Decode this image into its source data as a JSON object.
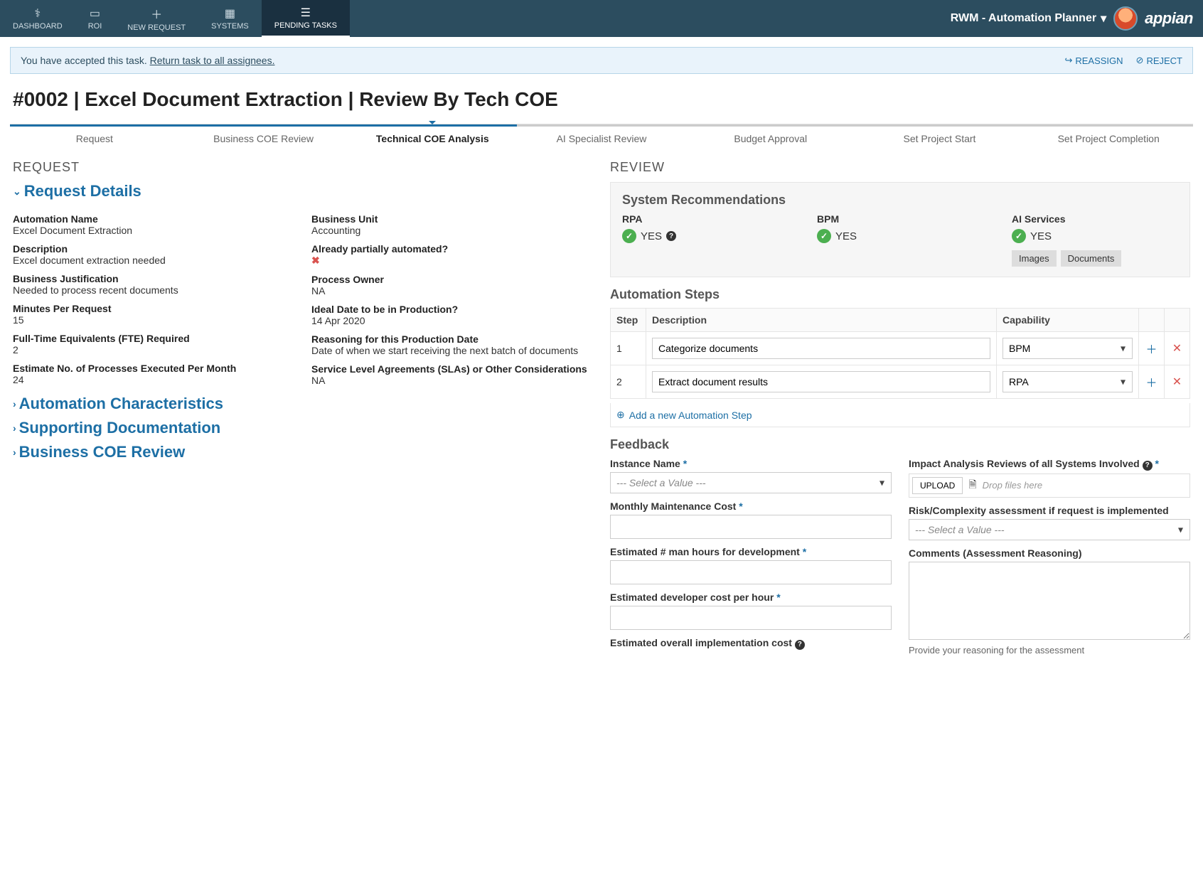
{
  "topnav": {
    "tabs": [
      {
        "icon": "⎍",
        "label": "DASHBOARD"
      },
      {
        "icon": "⬚",
        "label": "ROI"
      },
      {
        "icon": "＋",
        "label": "NEW REQUEST"
      },
      {
        "icon": "▦",
        "label": "SYSTEMS"
      },
      {
        "icon": "☰",
        "label": "PENDING TASKS"
      }
    ],
    "app_name": "RWM - Automation Planner",
    "logo": "appian"
  },
  "banner": {
    "text": "You have accepted this task.",
    "link": "Return task to all assignees.",
    "reassign": "REASSIGN",
    "reject": "REJECT"
  },
  "page_title": "#0002 | Excel Document Extraction | Review By Tech COE",
  "subtabs": [
    "Request",
    "Business COE Review",
    "Technical COE Analysis",
    "AI Specialist Review",
    "Budget Approval",
    "Set Project Start",
    "Set Project Completion"
  ],
  "active_subtab": 2,
  "request": {
    "section": "REQUEST",
    "accordion_open": "Request Details",
    "fields_left": [
      {
        "label": "Automation Name",
        "value": "Excel Document Extraction"
      },
      {
        "label": "Description",
        "value": "Excel document extraction needed"
      },
      {
        "label": "Business Justification",
        "value": "Needed to process recent documents"
      },
      {
        "label": "Minutes Per Request",
        "value": "15"
      },
      {
        "label": "Full-Time Equivalents (FTE) Required",
        "value": "2"
      },
      {
        "label": "Estimate No. of Processes Executed Per Month",
        "value": "24"
      }
    ],
    "fields_right": [
      {
        "label": "Business Unit",
        "value": "Accounting"
      },
      {
        "label": "Already partially automated?",
        "value": "x",
        "red": true
      },
      {
        "label": "Process Owner",
        "value": "NA"
      },
      {
        "label": "Ideal Date to be in Production?",
        "value": "14 Apr 2020"
      },
      {
        "label": "Reasoning for this Production Date",
        "value": "Date of when we start receiving the next batch of documents"
      },
      {
        "label": "Service Level Agreements (SLAs) or Other Considerations",
        "value": "NA"
      }
    ],
    "accordions_closed": [
      "Automation Characteristics",
      "Supporting Documentation",
      "Business COE Review"
    ]
  },
  "review": {
    "section": "REVIEW",
    "recommendations": {
      "title": "System Recommendations",
      "cols": [
        {
          "label": "RPA",
          "value": "YES",
          "help": true
        },
        {
          "label": "BPM",
          "value": "YES"
        },
        {
          "label": "AI Services",
          "value": "YES",
          "chips": [
            "Images",
            "Documents"
          ]
        }
      ]
    },
    "steps": {
      "title": "Automation Steps",
      "headers": [
        "Step",
        "Description",
        "Capability",
        "",
        ""
      ],
      "rows": [
        {
          "step": "1",
          "desc": "Categorize documents",
          "cap": "BPM"
        },
        {
          "step": "2",
          "desc": "Extract document results",
          "cap": "RPA"
        }
      ],
      "add": "Add a new Automation Step"
    },
    "feedback": {
      "title": "Feedback",
      "instance_label": "Instance Name",
      "instance_placeholder": "--- Select a Value ---",
      "monthly_label": "Monthly Maintenance Cost",
      "hours_label": "Estimated # man hours for development",
      "devcost_label": "Estimated developer cost per hour",
      "overall_label": "Estimated overall implementation cost",
      "impact_label": "Impact Analysis Reviews of all Systems Involved",
      "upload_label": "UPLOAD",
      "drop_text": "Drop files here",
      "risk_label": "Risk/Complexity assessment if request is implemented",
      "risk_placeholder": "--- Select a Value ---",
      "comments_label": "Comments (Assessment Reasoning)",
      "comments_helper": "Provide your reasoning for the assessment"
    }
  }
}
